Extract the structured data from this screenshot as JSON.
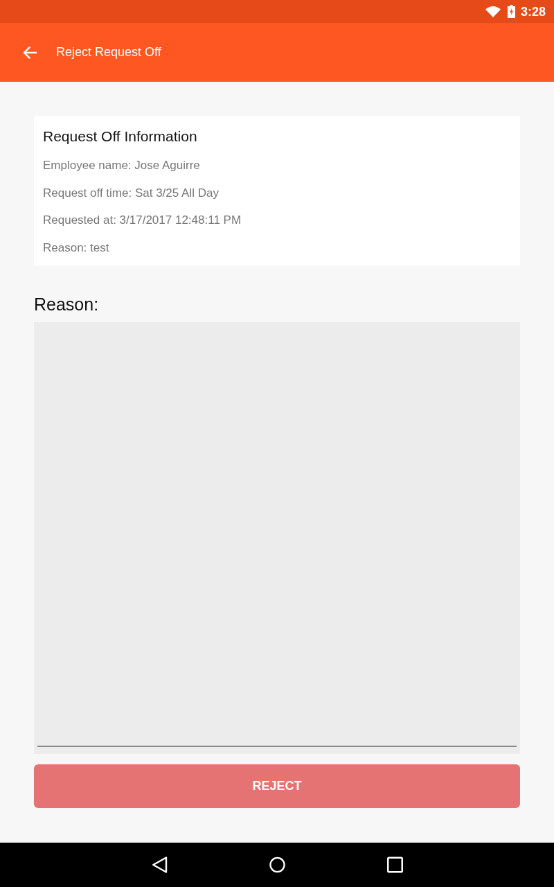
{
  "status_bar": {
    "time": "3:28"
  },
  "app_bar": {
    "title": "Reject Request Off"
  },
  "info_card": {
    "title": "Request Off Information",
    "lines": [
      "Employee name: Jose Aguirre",
      "Request off time: Sat 3/25 All Day",
      "Requested at: 3/17/2017 12:48:11 PM",
      "Reason: test"
    ]
  },
  "reason": {
    "label": "Reason:"
  },
  "button": {
    "label": "REJECT"
  }
}
